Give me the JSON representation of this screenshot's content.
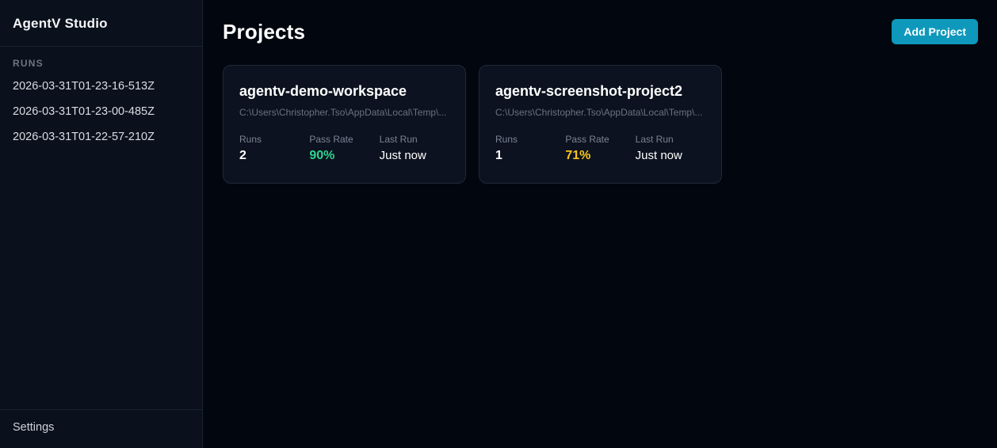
{
  "app": {
    "title": "AgentV Studio"
  },
  "colors": {
    "accent": "#0e98bc",
    "pass_green": "#2fd38f",
    "pass_amber": "#f5c518",
    "sidebar_bg": "#0a101c",
    "main_bg": "#02060e",
    "card_bg": "#0c121f",
    "card_border": "#202938"
  },
  "sidebar": {
    "runs_label": "RUNS",
    "runs": [
      "2026-03-31T01-23-16-513Z",
      "2026-03-31T01-23-00-485Z",
      "2026-03-31T01-22-57-210Z"
    ],
    "settings_label": "Settings"
  },
  "main": {
    "title": "Projects",
    "add_button_label": "Add Project"
  },
  "projects": [
    {
      "name": "agentv-demo-workspace",
      "path": "C:\\Users\\Christopher.Tso\\AppData\\Local\\Temp\\...",
      "runs_label": "Runs",
      "runs": "2",
      "pass_rate_label": "Pass Rate",
      "pass_rate": "90%",
      "pass_rate_color": "#2fd38f",
      "last_run_label": "Last Run",
      "last_run": "Just now"
    },
    {
      "name": "agentv-screenshot-project2",
      "path": "C:\\Users\\Christopher.Tso\\AppData\\Local\\Temp\\...",
      "runs_label": "Runs",
      "runs": "1",
      "pass_rate_label": "Pass Rate",
      "pass_rate": "71%",
      "pass_rate_color": "#f5c518",
      "last_run_label": "Last Run",
      "last_run": "Just now"
    }
  ]
}
